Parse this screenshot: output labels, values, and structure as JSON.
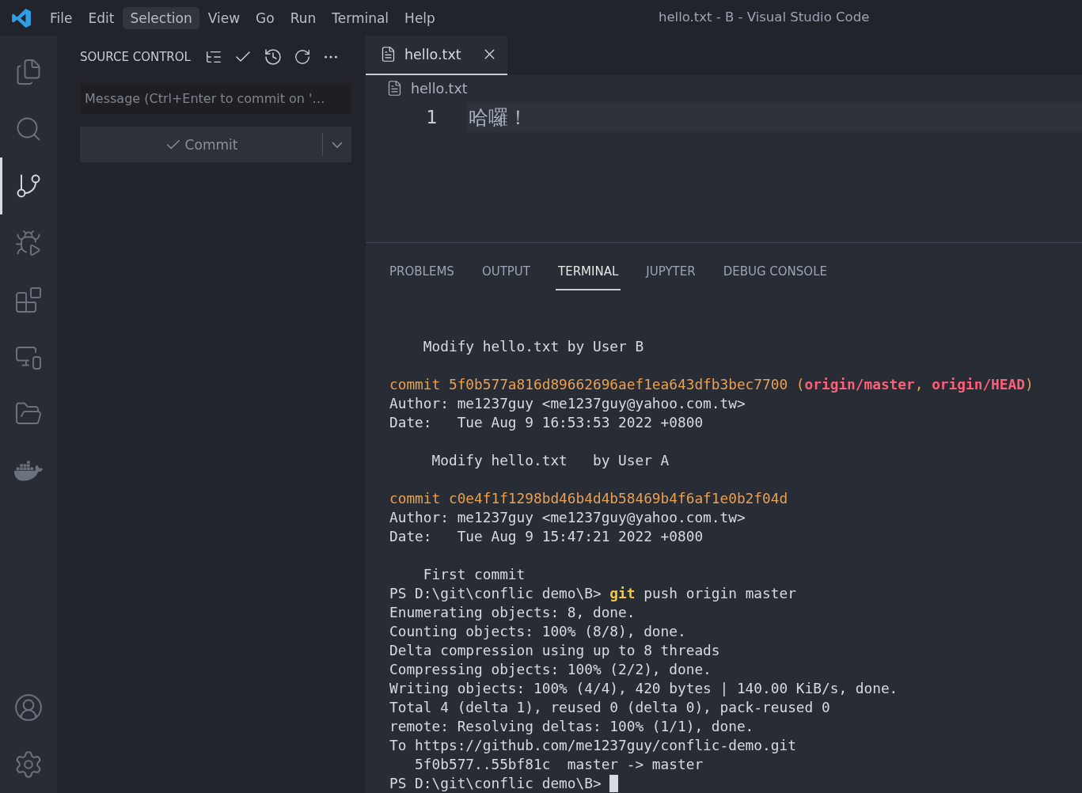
{
  "window": {
    "title": "hello.txt - B - Visual Studio Code"
  },
  "menu": [
    {
      "label": "File",
      "highlighted": false
    },
    {
      "label": "Edit",
      "highlighted": false
    },
    {
      "label": "Selection",
      "highlighted": true
    },
    {
      "label": "View",
      "highlighted": false
    },
    {
      "label": "Go",
      "highlighted": false
    },
    {
      "label": "Run",
      "highlighted": false
    },
    {
      "label": "Terminal",
      "highlighted": false
    },
    {
      "label": "Help",
      "highlighted": false
    }
  ],
  "activity_bar": [
    {
      "selected": false
    },
    {
      "selected": false
    },
    {
      "selected": true
    },
    {
      "selected": false
    },
    {
      "selected": false
    },
    {
      "selected": false
    },
    {
      "selected": false
    },
    {
      "selected": false
    }
  ],
  "sidebar": {
    "title": "SOURCE CONTROL",
    "message": {
      "placeholder": "Message (Ctrl+Enter to commit on '…"
    },
    "commit_button": "Commit"
  },
  "editor": {
    "tabs": [
      {
        "label": "hello.txt",
        "selected": true
      }
    ],
    "breadcrumb": "hello.txt",
    "lines": [
      {
        "number": "1",
        "text": "哈囉！"
      }
    ]
  },
  "panel": {
    "tabs": [
      {
        "label": "PROBLEMS",
        "selected": false
      },
      {
        "label": "OUTPUT",
        "selected": false
      },
      {
        "label": "TERMINAL",
        "selected": true
      },
      {
        "label": "JUPYTER",
        "selected": false
      },
      {
        "label": "DEBUG CONSOLE",
        "selected": false
      }
    ],
    "terminal": [
      {
        "kind": "text",
        "segments": [
          {
            "kind": "plain",
            "text": "    Modify hello.txt by User B"
          }
        ]
      },
      {
        "kind": "blank"
      },
      {
        "kind": "text",
        "segments": [
          {
            "kind": "commit",
            "text": "commit 5f0b577a816d89662696aef1ea643dfb3bec7700 ("
          },
          {
            "kind": "ref",
            "text": "origin/master"
          },
          {
            "kind": "commit",
            "text": ", "
          },
          {
            "kind": "ref",
            "text": "origin/HEAD"
          },
          {
            "kind": "commit",
            "text": ")"
          }
        ]
      },
      {
        "kind": "text",
        "segments": [
          {
            "kind": "plain",
            "text": "Author: me1237guy <me1237guy@yahoo.com.tw>"
          }
        ]
      },
      {
        "kind": "text",
        "segments": [
          {
            "kind": "plain",
            "text": "Date:   Tue Aug 9 16:53:53 2022 +0800"
          }
        ]
      },
      {
        "kind": "blank"
      },
      {
        "kind": "text",
        "segments": [
          {
            "kind": "plain",
            "text": "     Modify hello.txt   by User A"
          }
        ]
      },
      {
        "kind": "blank"
      },
      {
        "kind": "text",
        "segments": [
          {
            "kind": "commit",
            "text": "commit c0e4f1f1298bd46b4d4b58469b4f6af1e0b2f04d"
          }
        ]
      },
      {
        "kind": "text",
        "segments": [
          {
            "kind": "plain",
            "text": "Author: me1237guy <me1237guy@yahoo.com.tw>"
          }
        ]
      },
      {
        "kind": "text",
        "segments": [
          {
            "kind": "plain",
            "text": "Date:   Tue Aug 9 15:47:21 2022 +0800"
          }
        ]
      },
      {
        "kind": "blank"
      },
      {
        "kind": "text",
        "segments": [
          {
            "kind": "plain",
            "text": "    First commit"
          }
        ]
      },
      {
        "kind": "text",
        "segments": [
          {
            "kind": "plain",
            "text": "PS D:\\git\\conflic demo\\B> "
          },
          {
            "kind": "command",
            "text": "git"
          },
          {
            "kind": "plain",
            "text": " push origin master"
          }
        ]
      },
      {
        "kind": "text",
        "segments": [
          {
            "kind": "plain",
            "text": "Enumerating objects: 8, done."
          }
        ]
      },
      {
        "kind": "text",
        "segments": [
          {
            "kind": "plain",
            "text": "Counting objects: 100% (8/8), done."
          }
        ]
      },
      {
        "kind": "text",
        "segments": [
          {
            "kind": "plain",
            "text": "Delta compression using up to 8 threads"
          }
        ]
      },
      {
        "kind": "text",
        "segments": [
          {
            "kind": "plain",
            "text": "Compressing objects: 100% (2/2), done."
          }
        ]
      },
      {
        "kind": "text",
        "segments": [
          {
            "kind": "plain",
            "text": "Writing objects: 100% (4/4), 420 bytes | 140.00 KiB/s, done."
          }
        ]
      },
      {
        "kind": "text",
        "segments": [
          {
            "kind": "plain",
            "text": "Total 4 (delta 1), reused 0 (delta 0), pack-reused 0"
          }
        ]
      },
      {
        "kind": "text",
        "segments": [
          {
            "kind": "plain",
            "text": "remote: Resolving deltas: 100% (1/1), done."
          }
        ]
      },
      {
        "kind": "text",
        "segments": [
          {
            "kind": "plain",
            "text": "To https://github.com/me1237guy/conflic-demo.git"
          }
        ]
      },
      {
        "kind": "text",
        "segments": [
          {
            "kind": "plain",
            "text": "   5f0b577..55bf81c  master -> master"
          }
        ]
      },
      {
        "kind": "prompt",
        "segments": [
          {
            "kind": "plain",
            "text": "PS D:\\git\\conflic demo\\B> "
          }
        ]
      }
    ]
  }
}
